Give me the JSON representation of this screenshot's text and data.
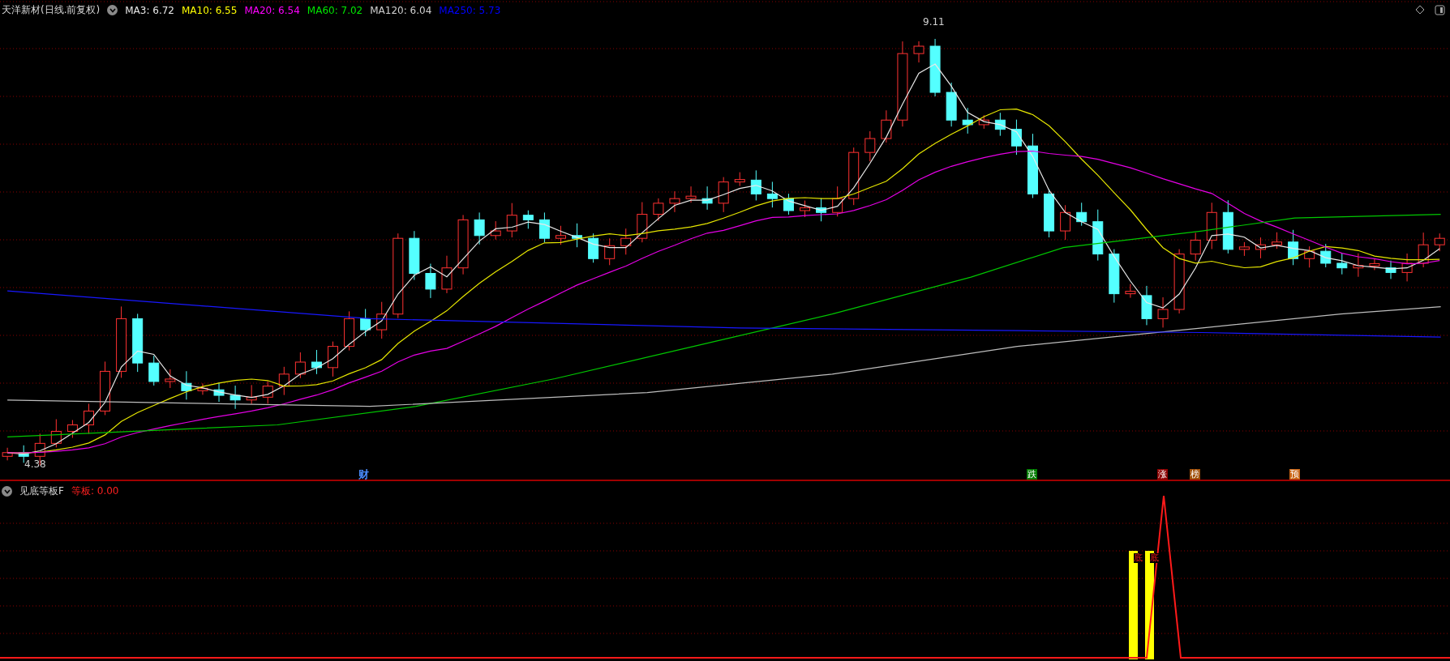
{
  "chart": {
    "title": "天洋新材(日线.前复权)",
    "ma_legend": [
      {
        "label": "MA3: 6.72",
        "color": "#e8e8e8"
      },
      {
        "label": "MA10: 6.55",
        "color": "#ffff00"
      },
      {
        "label": "MA20: 6.54",
        "color": "#ff00ff"
      },
      {
        "label": "MA60: 7.02",
        "color": "#00e600"
      },
      {
        "label": "MA120: 6.04",
        "color": "#d0d0d0"
      },
      {
        "label": "MA250: 5.73",
        "color": "#0000ff"
      }
    ],
    "high_label": "9.11",
    "low_label": "4.38",
    "event_marks": [
      {
        "text": "财",
        "kind": "text",
        "color": "#4a8cff"
      },
      {
        "text": "跌",
        "kind": "badge",
        "color": "#007a00"
      },
      {
        "text": "涨",
        "kind": "badge",
        "color": "#8b0000"
      },
      {
        "text": "榜",
        "kind": "badge",
        "color": "#a0500a"
      },
      {
        "text": "预",
        "kind": "badge",
        "color": "#c86414"
      }
    ]
  },
  "indicator": {
    "title": "见底等板F",
    "value": "等板: 0.00",
    "signals": [
      {
        "text": "底"
      },
      {
        "text": "底"
      }
    ]
  }
}
